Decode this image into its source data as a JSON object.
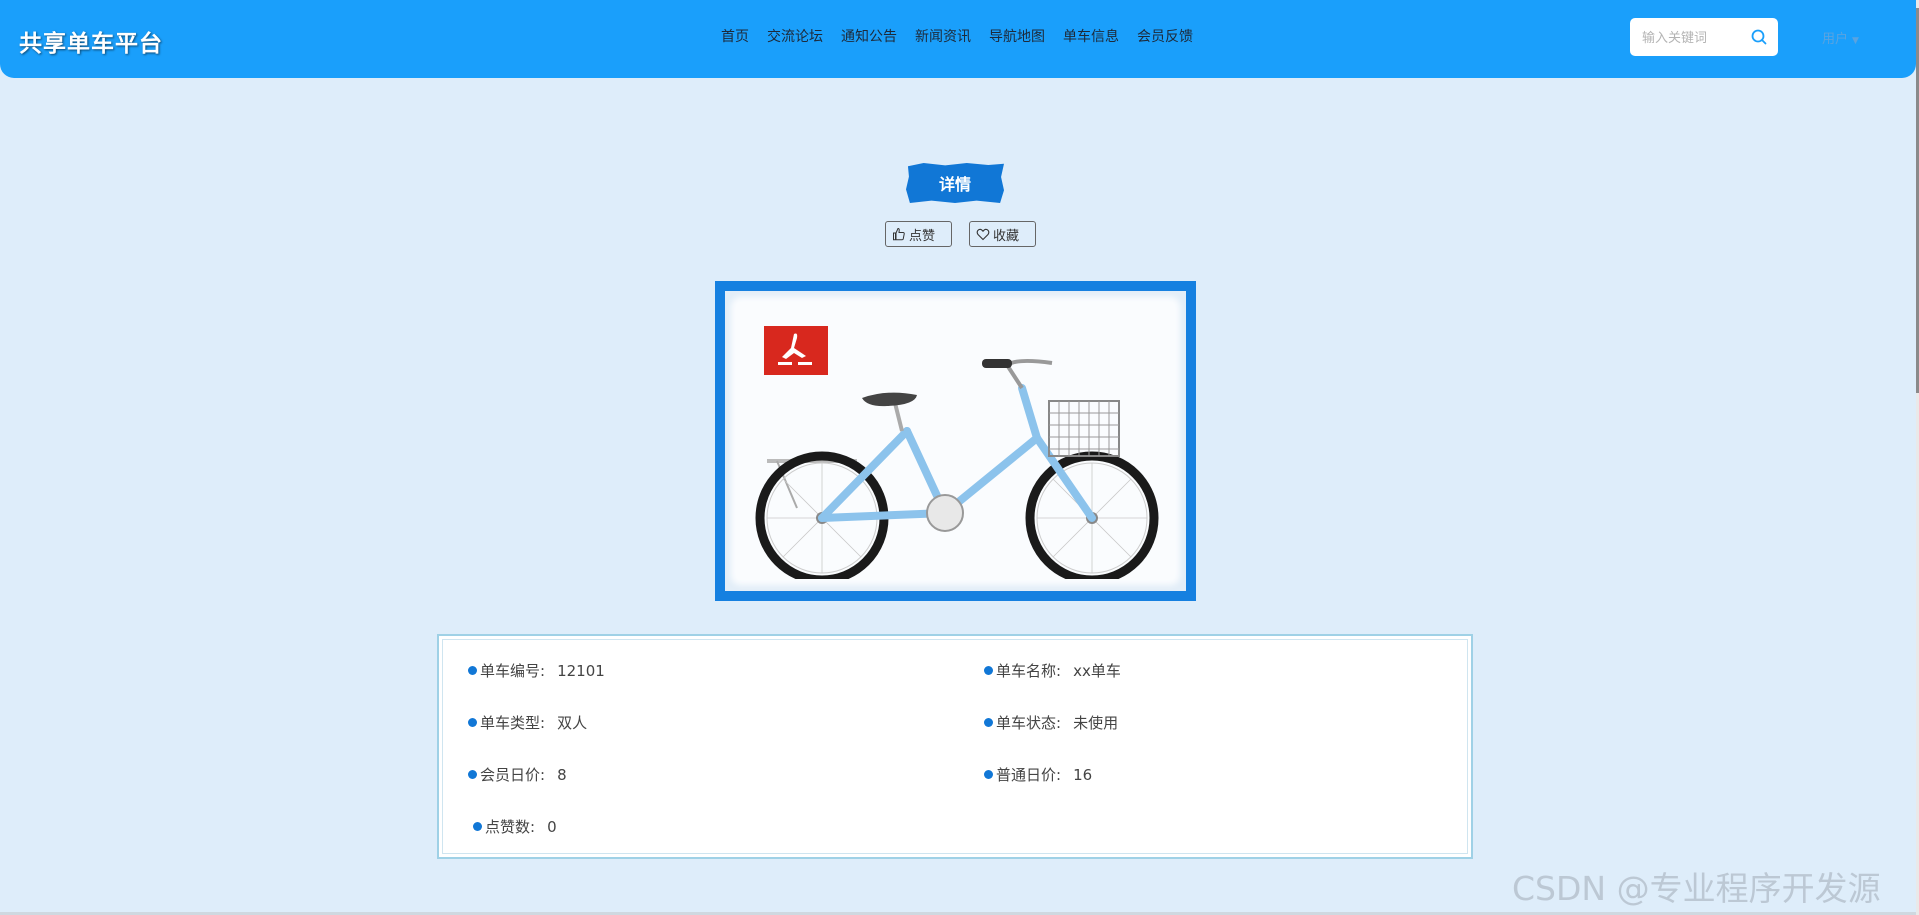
{
  "header": {
    "brand": "共享单车平台",
    "nav": [
      "首页",
      "交流论坛",
      "通知公告",
      "新闻资讯",
      "导航地图",
      "单车信息",
      "会员反馈"
    ],
    "search_placeholder": "输入关键词",
    "user_label": "用户",
    "colors": {
      "header_bg": "#1a9ffb",
      "accent": "#1177d6"
    }
  },
  "detail": {
    "title": "详情",
    "like_label": "点赞",
    "favorite_label": "收藏"
  },
  "info": {
    "items": [
      {
        "label": "单车编号:",
        "value": "12101"
      },
      {
        "label": "单车名称:",
        "value": "xx单车"
      },
      {
        "label": "单车类型:",
        "value": "双人"
      },
      {
        "label": "单车状态:",
        "value": "未使用"
      },
      {
        "label": "会员日价:",
        "value": "8"
      },
      {
        "label": "普通日价:",
        "value": "16"
      },
      {
        "label": "点赞数:",
        "value": "0"
      }
    ]
  },
  "watermark": "CSDN @专业程序开发源"
}
